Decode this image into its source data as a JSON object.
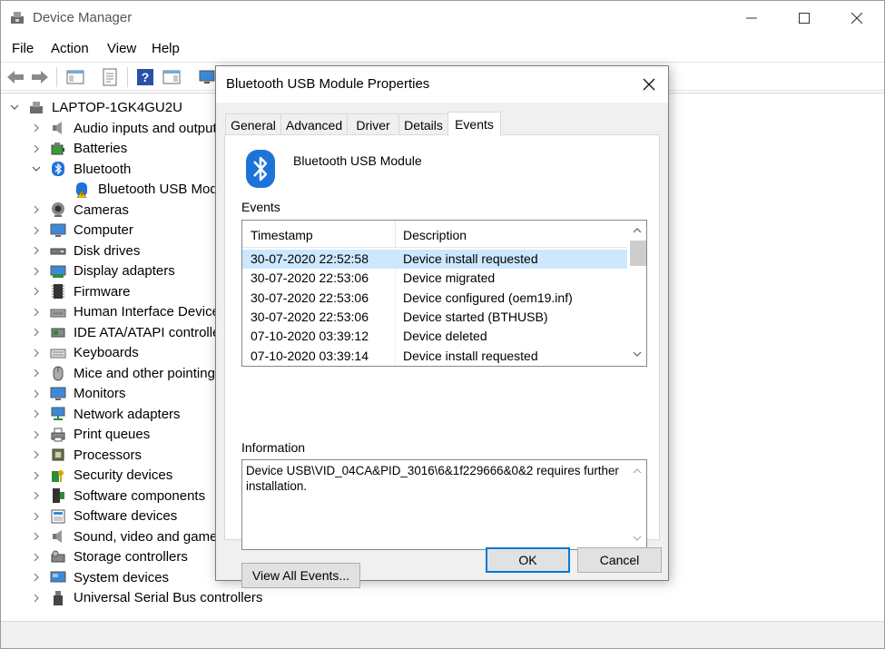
{
  "window": {
    "title": "Device Manager"
  },
  "menu": [
    "File",
    "Action",
    "View",
    "Help"
  ],
  "tree": {
    "root": "LAPTOP-1GK4GU2U",
    "categories": [
      {
        "label": "Audio inputs and outputs",
        "icon": "speaker-icon",
        "expanded": false
      },
      {
        "label": "Batteries",
        "icon": "battery-icon",
        "expanded": false
      },
      {
        "label": "Bluetooth",
        "icon": "bluetooth-icon",
        "expanded": true
      },
      {
        "label": "Bluetooth USB Module",
        "icon": "bluetooth-warning-icon",
        "child": true
      },
      {
        "label": "Cameras",
        "icon": "camera-icon",
        "expanded": false
      },
      {
        "label": "Computer",
        "icon": "monitor-icon",
        "expanded": false
      },
      {
        "label": "Disk drives",
        "icon": "disk-drive-icon",
        "expanded": false
      },
      {
        "label": "Display adapters",
        "icon": "display-adapter-icon",
        "expanded": false
      },
      {
        "label": "Firmware",
        "icon": "firmware-chip-icon",
        "expanded": false
      },
      {
        "label": "Human Interface Devices",
        "icon": "hid-icon",
        "expanded": false
      },
      {
        "label": "IDE ATA/ATAPI controllers",
        "icon": "ide-controller-icon",
        "expanded": false
      },
      {
        "label": "Keyboards",
        "icon": "keyboard-icon",
        "expanded": false
      },
      {
        "label": "Mice and other pointing devices",
        "icon": "mouse-icon",
        "expanded": false
      },
      {
        "label": "Monitors",
        "icon": "monitor-icon",
        "expanded": false
      },
      {
        "label": "Network adapters",
        "icon": "network-adapter-icon",
        "expanded": false
      },
      {
        "label": "Print queues",
        "icon": "printer-icon",
        "expanded": false
      },
      {
        "label": "Processors",
        "icon": "processor-icon",
        "expanded": false
      },
      {
        "label": "Security devices",
        "icon": "security-key-icon",
        "expanded": false
      },
      {
        "label": "Software components",
        "icon": "software-component-icon",
        "expanded": false
      },
      {
        "label": "Software devices",
        "icon": "software-device-icon",
        "expanded": false
      },
      {
        "label": "Sound, video and game controllers",
        "icon": "speaker-icon",
        "expanded": false
      },
      {
        "label": "Storage controllers",
        "icon": "storage-controller-icon",
        "expanded": false
      },
      {
        "label": "System devices",
        "icon": "system-device-icon",
        "expanded": false
      },
      {
        "label": "Universal Serial Bus controllers",
        "icon": "usb-icon",
        "expanded": false
      }
    ]
  },
  "dialog": {
    "title": "Bluetooth USB Module Properties",
    "tabs": [
      "General",
      "Advanced",
      "Driver",
      "Details",
      "Events"
    ],
    "active_tab": "Events",
    "device_name": "Bluetooth USB Module",
    "events_label": "Events",
    "columns": [
      "Timestamp",
      "Description"
    ],
    "events": [
      {
        "timestamp": "30-07-2020 22:52:58",
        "description": "Device install requested",
        "selected": true
      },
      {
        "timestamp": "30-07-2020 22:53:06",
        "description": "Device migrated"
      },
      {
        "timestamp": "30-07-2020 22:53:06",
        "description": "Device configured (oem19.inf)"
      },
      {
        "timestamp": "30-07-2020 22:53:06",
        "description": "Device started (BTHUSB)"
      },
      {
        "timestamp": "07-10-2020 03:39:12",
        "description": "Device deleted"
      },
      {
        "timestamp": "07-10-2020 03:39:14",
        "description": "Device install requested"
      }
    ],
    "information_label": "Information",
    "information_text": "Device USB\\VID_04CA&PID_3016\\6&1f229666&0&2 requires further installation.",
    "view_all_label": "View All Events...",
    "ok_label": "OK",
    "cancel_label": "Cancel"
  },
  "colors": {
    "selection": "#cce8ff",
    "default_button_border": "#0078d7",
    "bluetooth_blue": "#1e73d8"
  }
}
